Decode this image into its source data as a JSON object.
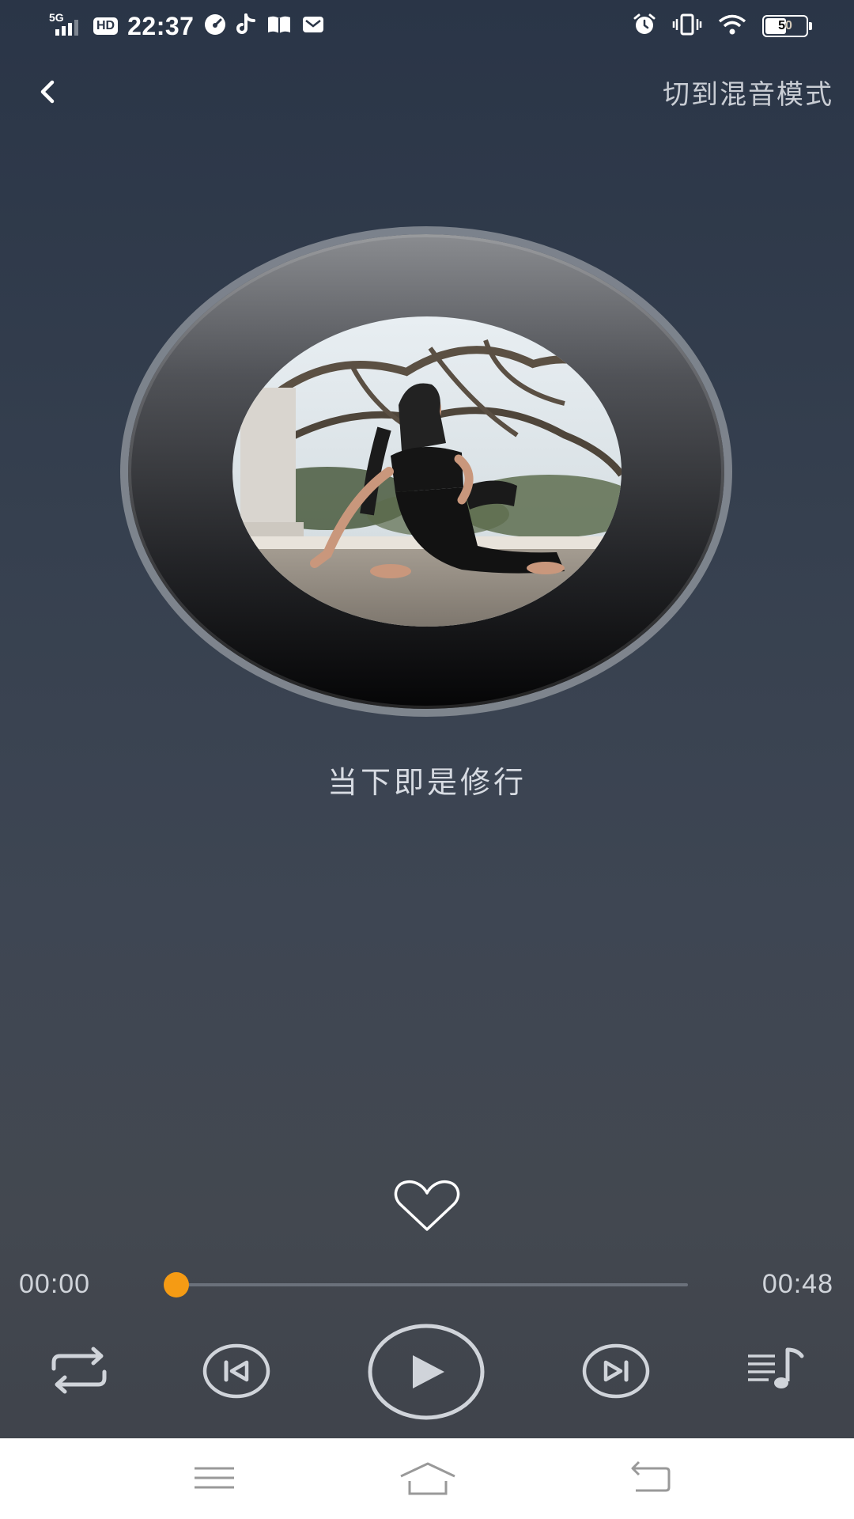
{
  "status_bar": {
    "network": "5G",
    "hd": "HD",
    "time": "22:37",
    "battery": "50",
    "left_icons": [
      "signal-icon",
      "hd-icon",
      "speedometer-icon",
      "tiktok-icon",
      "book-icon",
      "mail-icon"
    ],
    "right_icons": [
      "alarm-icon",
      "vibrate-icon",
      "wifi-icon",
      "battery-icon"
    ]
  },
  "header": {
    "back_icon": "chevron-left-icon",
    "mix_mode_label": "切到混音模式"
  },
  "player": {
    "track_title": "当下即是修行",
    "cover_image": "yoga-cover-image",
    "current_time": "00:00",
    "total_time": "00:48",
    "progress": 0.02,
    "liked": false
  },
  "colors": {
    "accent": "#f59b14",
    "background_top": "#2a3547",
    "background_bottom": "#3e424a",
    "icon": "#d0d4da"
  },
  "controls": [
    "repeat-icon",
    "skip-previous-icon",
    "play-icon",
    "skip-next-icon",
    "playlist-icon"
  ],
  "nav_bar": [
    "menu-icon",
    "home-icon",
    "back-icon"
  ]
}
